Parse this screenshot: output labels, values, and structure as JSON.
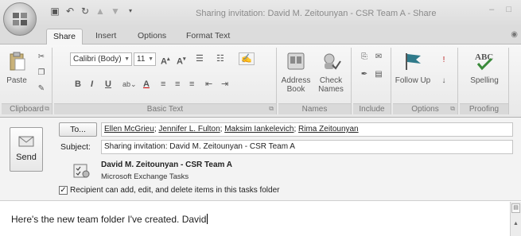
{
  "window": {
    "title": "Sharing invitation: David M. Zeitounyan - CSR Team A - Share",
    "controls": "– □"
  },
  "tabs": [
    {
      "label": "Share",
      "active": true
    },
    {
      "label": "Insert",
      "active": false
    },
    {
      "label": "Options",
      "active": false
    },
    {
      "label": "Format Text",
      "active": false
    }
  ],
  "ribbon": {
    "clipboard": {
      "label": "Clipboard",
      "paste": "Paste"
    },
    "basic_text": {
      "label": "Basic Text",
      "font": "Calibri (Body)",
      "size": "11"
    },
    "names": {
      "label": "Names",
      "address_book": "Address Book",
      "check_names": "Check Names"
    },
    "include": {
      "label": "Include"
    },
    "options": {
      "label": "Options",
      "follow_up": "Follow Up"
    },
    "proofing": {
      "label": "Proofing",
      "spelling": "Spelling"
    }
  },
  "message": {
    "send_label": "Send",
    "to_button": "To...",
    "recipients": [
      "Ellen McGrieu",
      "Jennifer L. Fulton",
      "Maksim Iankelevich",
      "Rima Zeitounyan"
    ],
    "subject_label": "Subject:",
    "subject": "Sharing invitation: David M. Zeitounyan - CSR Team A",
    "shared_item_name": "David M. Zeitounyan - CSR Team A",
    "shared_item_type": "Microsoft Exchange Tasks",
    "permission_checked": true,
    "permission_label": "Recipient can add, edit, and delete items in this tasks folder",
    "body": "Here's the new team folder I've created. David"
  },
  "colors": {
    "ribbon_bg": "#efefef",
    "flag": "#2f7a8a",
    "spelling_check": "#3a8a3a"
  }
}
